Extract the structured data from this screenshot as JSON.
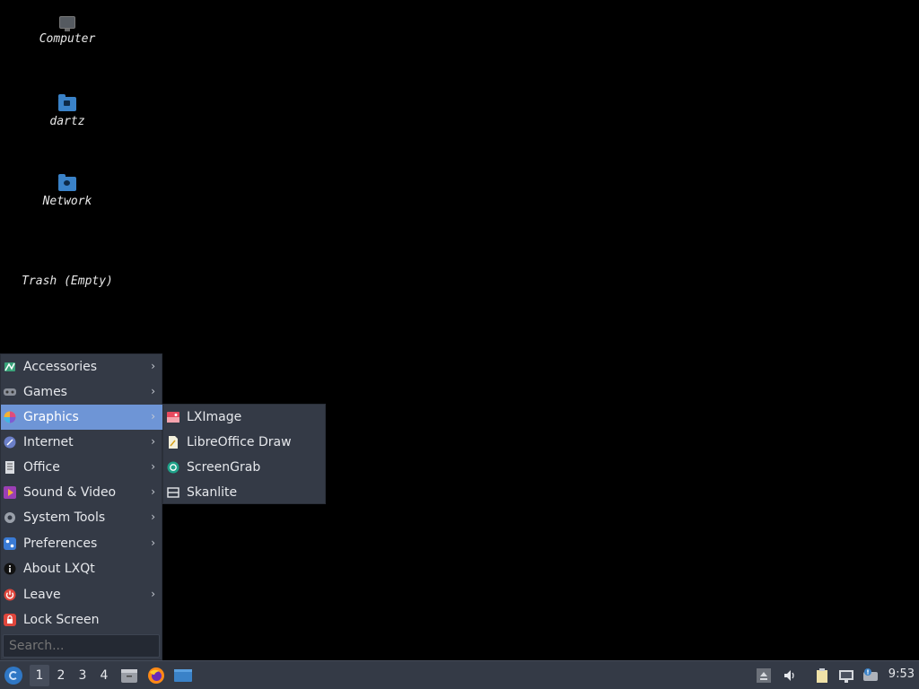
{
  "desktop": {
    "icons": [
      {
        "label": "Computer",
        "icon": "computer-icon"
      },
      {
        "label": "dartz",
        "icon": "home-folder-icon"
      },
      {
        "label": "Network",
        "icon": "network-folder-icon"
      },
      {
        "label": "Trash (Empty)",
        "icon": "trash-icon"
      }
    ]
  },
  "menu": {
    "items": [
      {
        "label": "Accessories",
        "icon": "accessories-icon",
        "has_submenu": true
      },
      {
        "label": "Games",
        "icon": "games-icon",
        "has_submenu": true
      },
      {
        "label": "Graphics",
        "icon": "graphics-icon",
        "has_submenu": true,
        "active": true
      },
      {
        "label": "Internet",
        "icon": "internet-icon",
        "has_submenu": true
      },
      {
        "label": "Office",
        "icon": "office-icon",
        "has_submenu": true
      },
      {
        "label": "Sound & Video",
        "icon": "sound-video-icon",
        "has_submenu": true
      },
      {
        "label": "System Tools",
        "icon": "system-tools-icon",
        "has_submenu": true
      },
      {
        "label": "Preferences",
        "icon": "preferences-icon",
        "has_submenu": true
      },
      {
        "label": "About LXQt",
        "icon": "info-icon",
        "has_submenu": false
      },
      {
        "label": "Leave",
        "icon": "power-icon",
        "has_submenu": true
      },
      {
        "label": "Lock Screen",
        "icon": "lock-icon",
        "has_submenu": false
      }
    ],
    "search_placeholder": "Search..."
  },
  "submenu": {
    "items": [
      {
        "label": "LXImage",
        "icon": "lximage-icon"
      },
      {
        "label": "LibreOffice Draw",
        "icon": "libreoffice-draw-icon"
      },
      {
        "label": "ScreenGrab",
        "icon": "screengrab-icon"
      },
      {
        "label": "Skanlite",
        "icon": "skanlite-icon"
      }
    ]
  },
  "taskbar": {
    "desktops": [
      "1",
      "2",
      "3",
      "4"
    ],
    "active_desktop": "1",
    "clock": "9:53"
  },
  "colors": {
    "panel_bg": "#343a46",
    "highlight": "#6e95d6",
    "desktop_bg": "#000000"
  }
}
